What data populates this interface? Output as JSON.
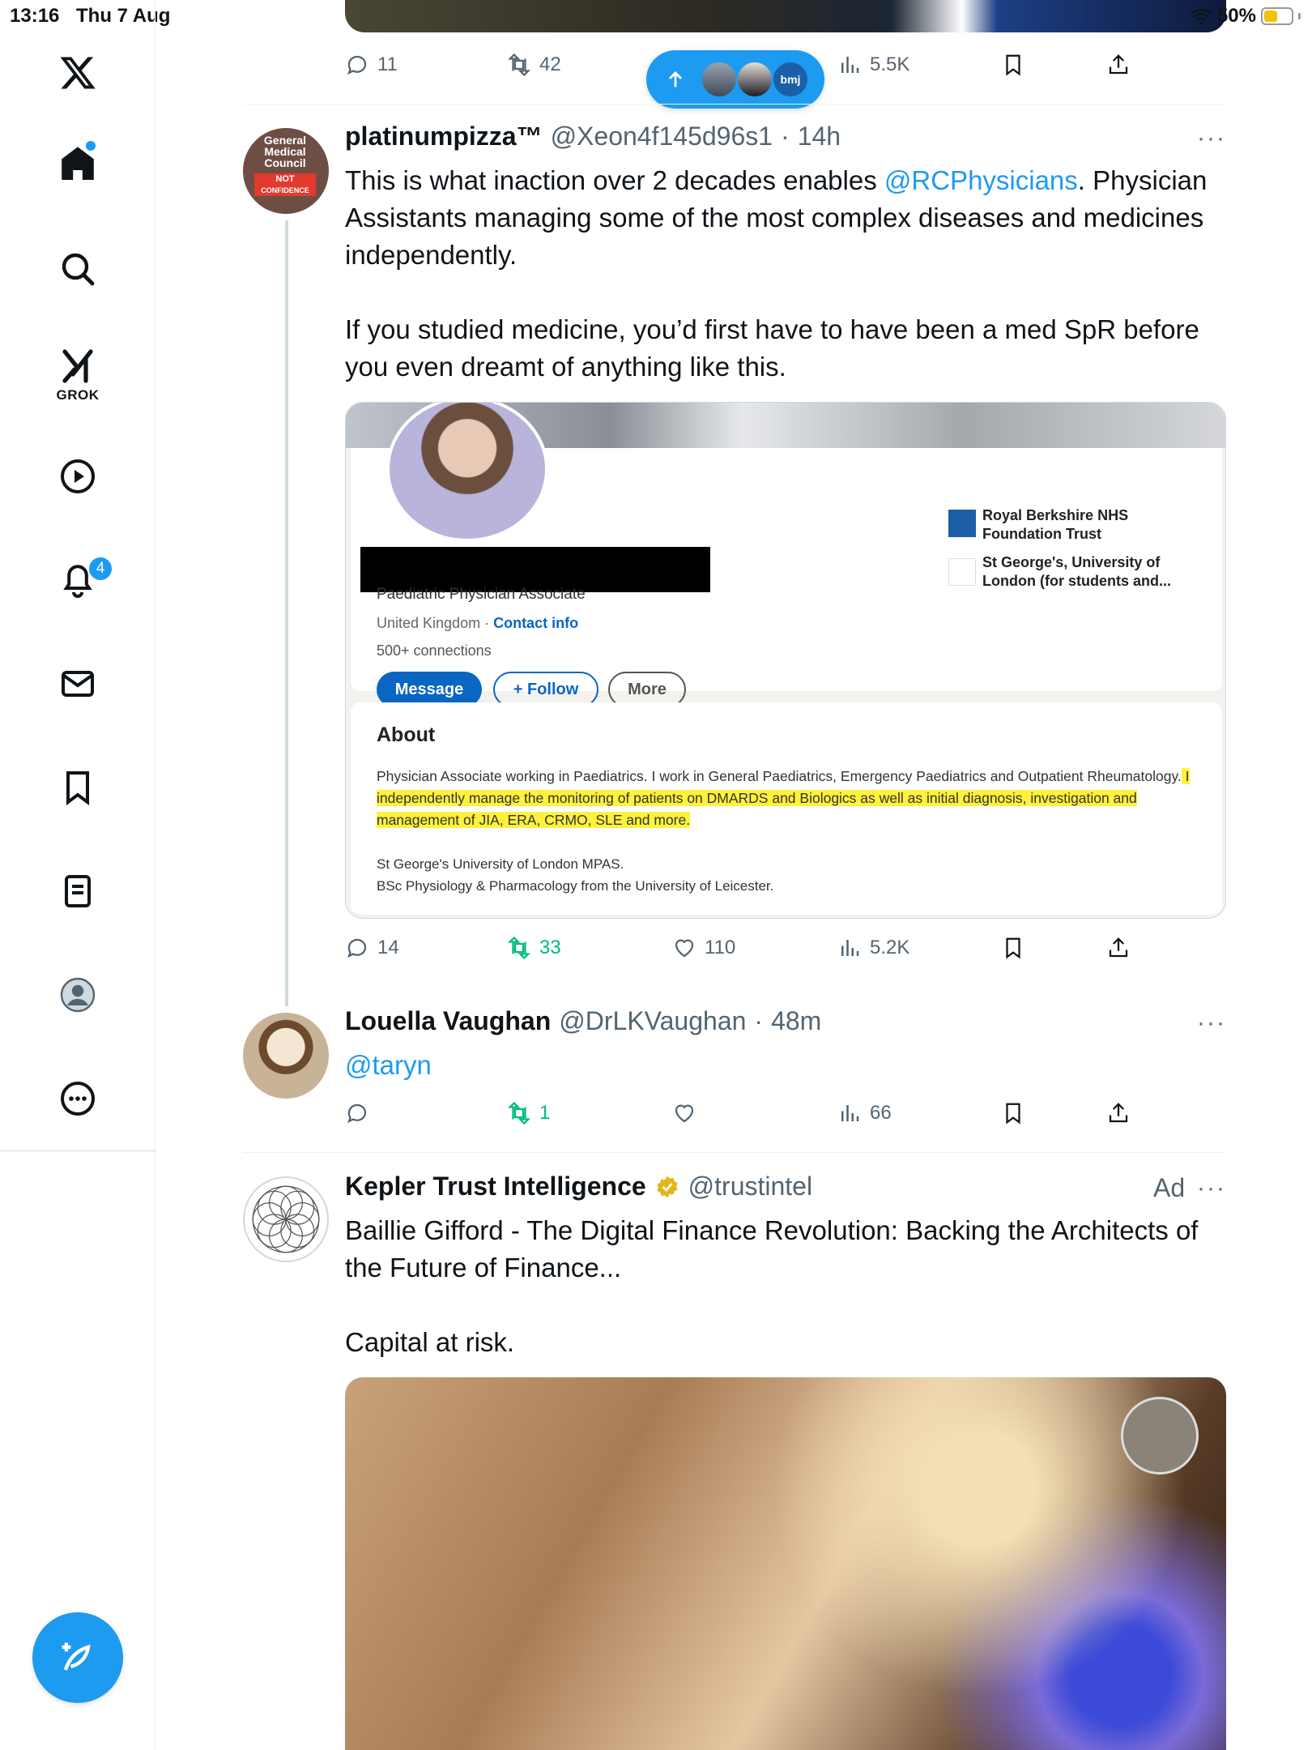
{
  "status_bar": {
    "time": "13:16",
    "date": "Thu 7 Aug",
    "battery": "50%",
    "battery_level": 0.5
  },
  "sidebar": {
    "items": [
      {
        "name": "home",
        "label": "Home"
      },
      {
        "name": "explore",
        "label": "Explore"
      },
      {
        "name": "grok",
        "label": "GROK"
      },
      {
        "name": "video",
        "label": "Video"
      },
      {
        "name": "notifications",
        "label": "Notifications",
        "badge": "4"
      },
      {
        "name": "messages",
        "label": "Messages"
      },
      {
        "name": "bookmarks",
        "label": "Bookmarks"
      },
      {
        "name": "lists",
        "label": "Lists"
      },
      {
        "name": "profile",
        "label": "Profile"
      },
      {
        "name": "more",
        "label": "More"
      }
    ]
  },
  "new_posts_pill": {
    "bmj_label": "bmj"
  },
  "previous_tweet": {
    "replies": "11",
    "retweets": "42",
    "views": "5.5K"
  },
  "tweet1": {
    "name": "platinumpizza™",
    "handle": "@Xeon4f145d96s1",
    "time": "14h",
    "avatar_lines": [
      "General",
      "Medical",
      "Council",
      "NOT",
      "CONFIDENCE"
    ],
    "text_before": "This is what inaction over 2 decades enables ",
    "mention": "@RCPhysicians",
    "text_after": ". Physician Assistants managing some of the most complex diseases and medicines independently.\n\nIf you studied medicine, you’d first have to have been a med SpR before you even dreamt of anything like this.",
    "replies": "14",
    "retweets": "33",
    "likes": "110",
    "views": "5.2K"
  },
  "linkedin_card": {
    "headline": "Paediatric Physician Associate",
    "location": "United Kingdom · ",
    "contact": "Contact info",
    "connections": "500+ connections",
    "btn_message": "Message",
    "btn_follow": "+ Follow",
    "btn_more": "More",
    "org1": "Royal Berkshire NHS Foundation Trust",
    "org2": "St George's, University of London (for students and...",
    "about_title": "About",
    "about_plain": "Physician Associate working in Paediatrics. I work in General Paediatrics, Emergency Paediatrics and Outpatient Rheumatology.",
    "about_highlight": " I independently manage the monitoring of patients on DMARDS and Biologics as well as initial diagnosis, investigation and management of JIA, ERA, CRMO, SLE and more.",
    "edu1": "St George's University of London MPAS.",
    "edu2": "BSc Physiology & Pharmacology from the University of Leicester."
  },
  "tweet2": {
    "name": "Louella Vaughan",
    "handle": "@DrLKVaughan",
    "time": "48m",
    "text": "@taryn",
    "retweets": "1",
    "views": "66"
  },
  "ad_tweet": {
    "name": "Kepler Trust Intelligence",
    "handle": "@trustintel",
    "ad_label": "Ad",
    "text": "Baillie Gifford - The Digital Finance Revolution: Backing the Architects of the Future of Finance...\n\nCapital at risk."
  },
  "colors": {
    "accent": "#1d9bf0",
    "retweet": "#00ba7c",
    "muted": "#536471",
    "highlight": "#fff23d",
    "linkedin": "#0a66c2"
  },
  "icons": [
    "x-logo-icon",
    "home-icon",
    "search-icon",
    "grok-icon",
    "video-icon",
    "bell-icon",
    "mail-icon",
    "bookmark-icon",
    "list-icon",
    "profile-icon",
    "more-icon",
    "compose-icon",
    "reply-icon",
    "retweet-icon",
    "like-icon",
    "views-icon",
    "share-icon",
    "verified-badge-icon"
  ]
}
